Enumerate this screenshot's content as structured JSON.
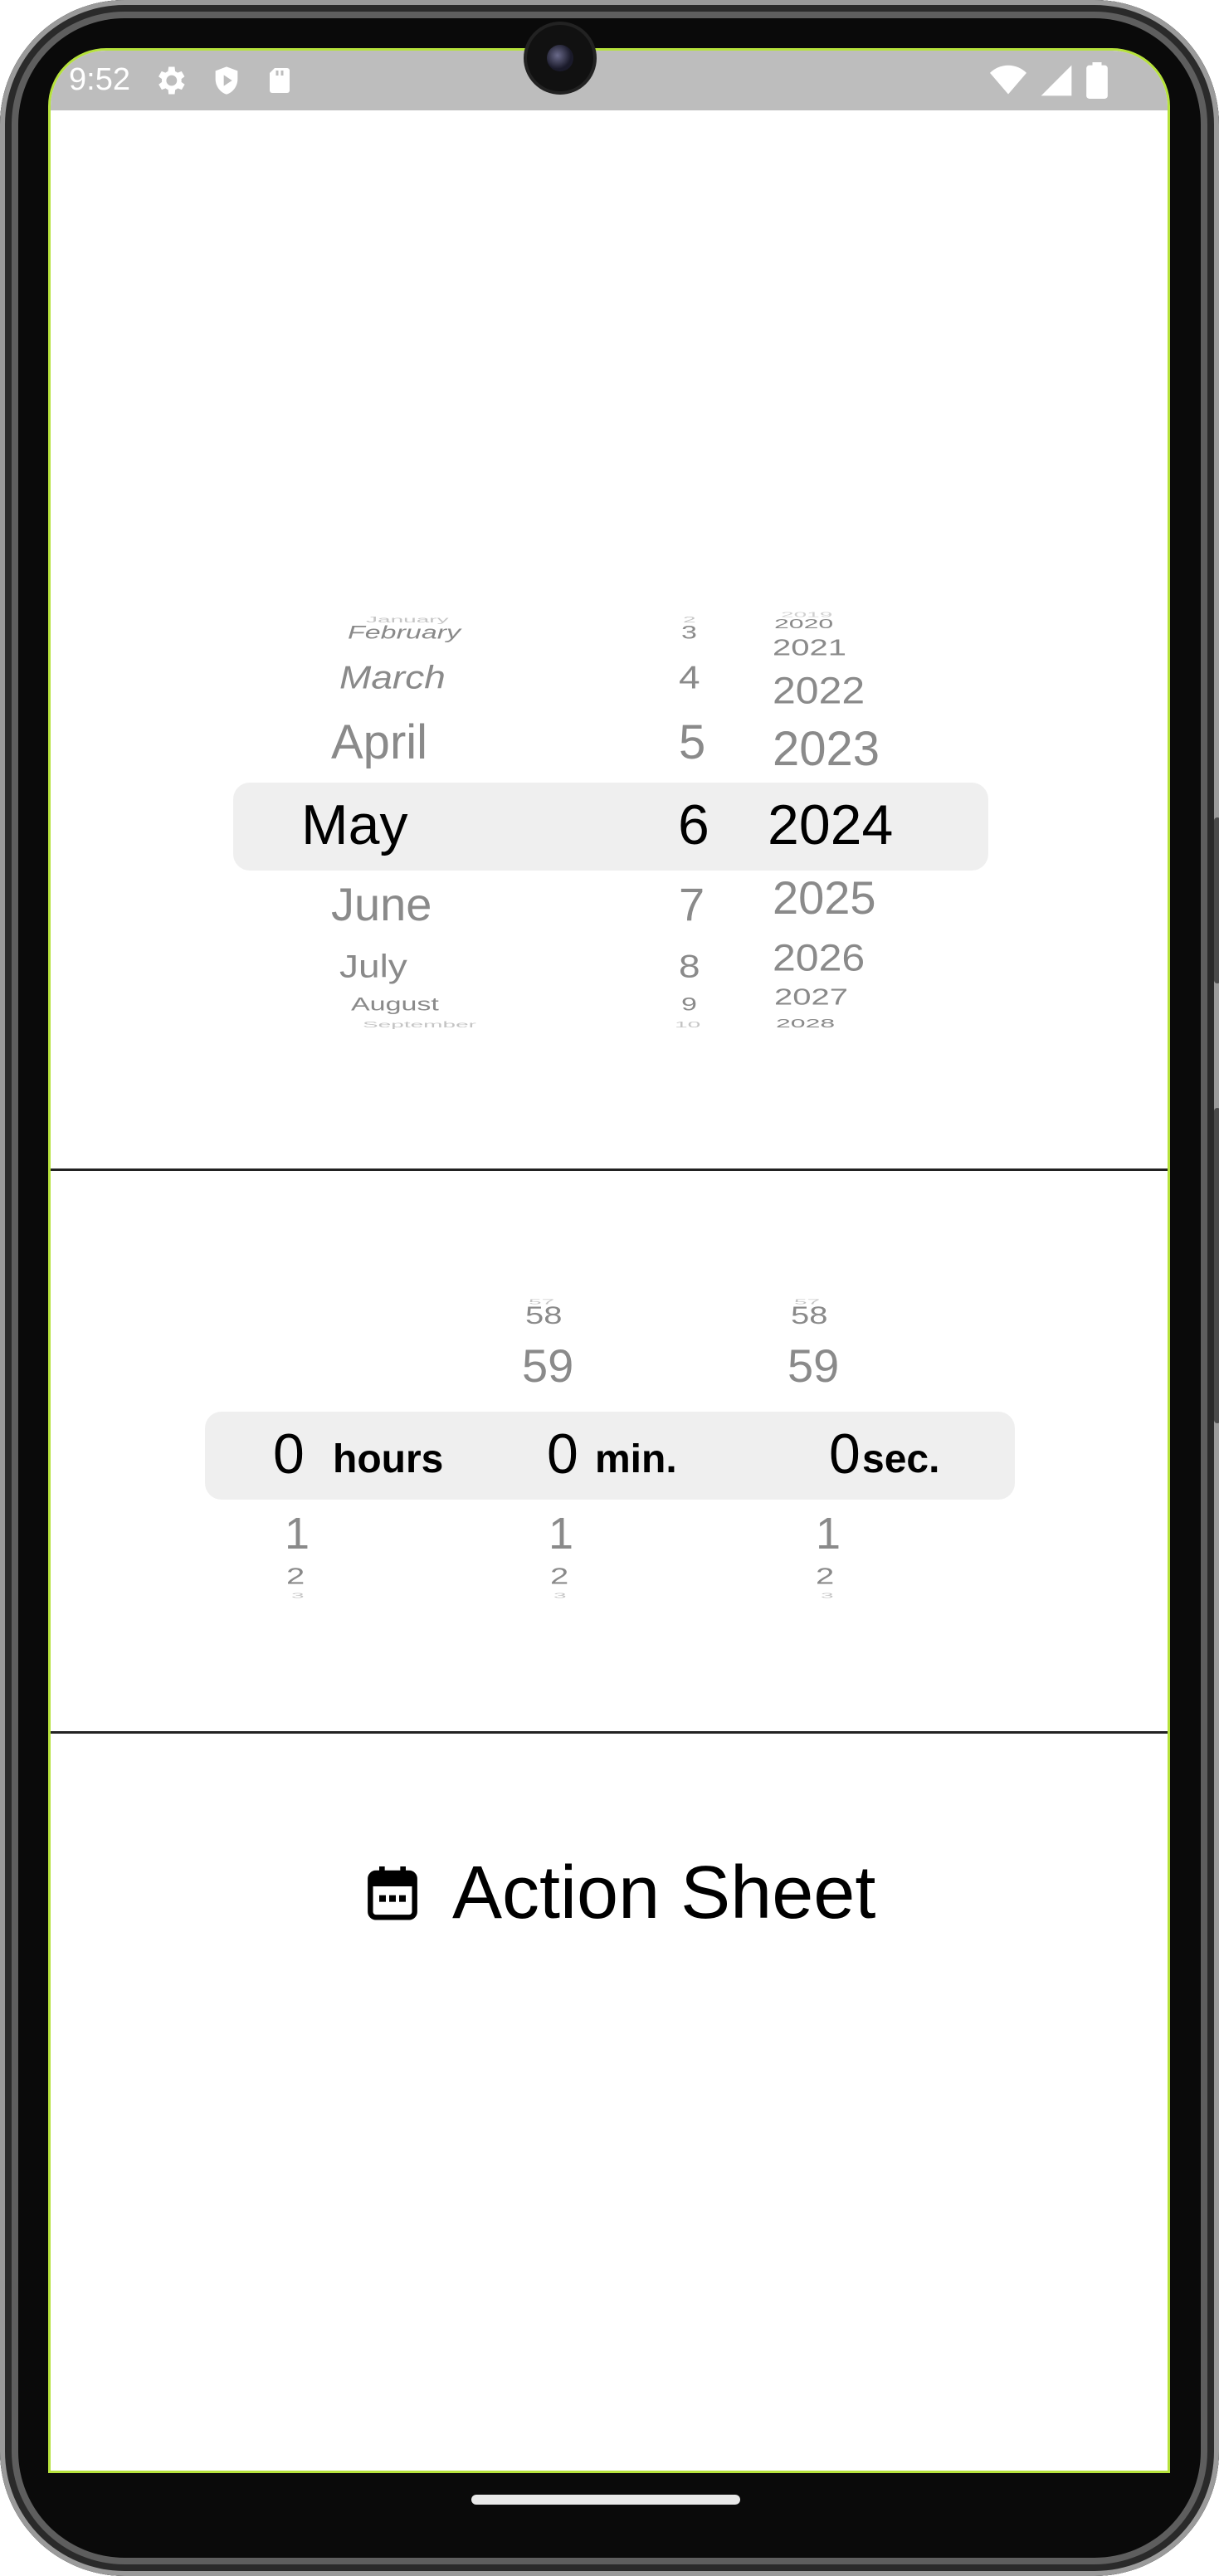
{
  "status_bar": {
    "time": "9:52",
    "icons": [
      "settings-icon",
      "shield-icon",
      "sd-card-icon",
      "wifi-icon",
      "signal-icon",
      "battery-icon"
    ]
  },
  "date_picker": {
    "months": [
      "January",
      "February",
      "March",
      "April",
      "May",
      "June",
      "July",
      "August",
      "September"
    ],
    "days": [
      "2",
      "3",
      "4",
      "5",
      "6",
      "7",
      "8",
      "9",
      "10"
    ],
    "years": [
      "2019",
      "2020",
      "2021",
      "2022",
      "2023",
      "2024",
      "2025",
      "2026",
      "2027",
      "2028"
    ],
    "selected": {
      "month": "May",
      "day": "6",
      "year": "2024"
    }
  },
  "time_picker": {
    "hours": [
      "",
      "",
      "0",
      "1",
      "2",
      "3"
    ],
    "minutes": [
      "57",
      "58",
      "59",
      "0",
      "1",
      "2",
      "3"
    ],
    "seconds": [
      "57",
      "58",
      "59",
      "0",
      "1",
      "2",
      "3"
    ],
    "selected": {
      "hours": "0",
      "minutes": "0",
      "seconds": "0"
    },
    "units": {
      "hours": "hours",
      "minutes": "min.",
      "seconds": "sec."
    }
  },
  "action_sheet": {
    "label": "Action Sheet",
    "icon": "calendar-icon"
  },
  "colors": {
    "highlight": "#efefef",
    "screen_border": "#b6e23c",
    "status_bar": "#bdbdbd"
  }
}
